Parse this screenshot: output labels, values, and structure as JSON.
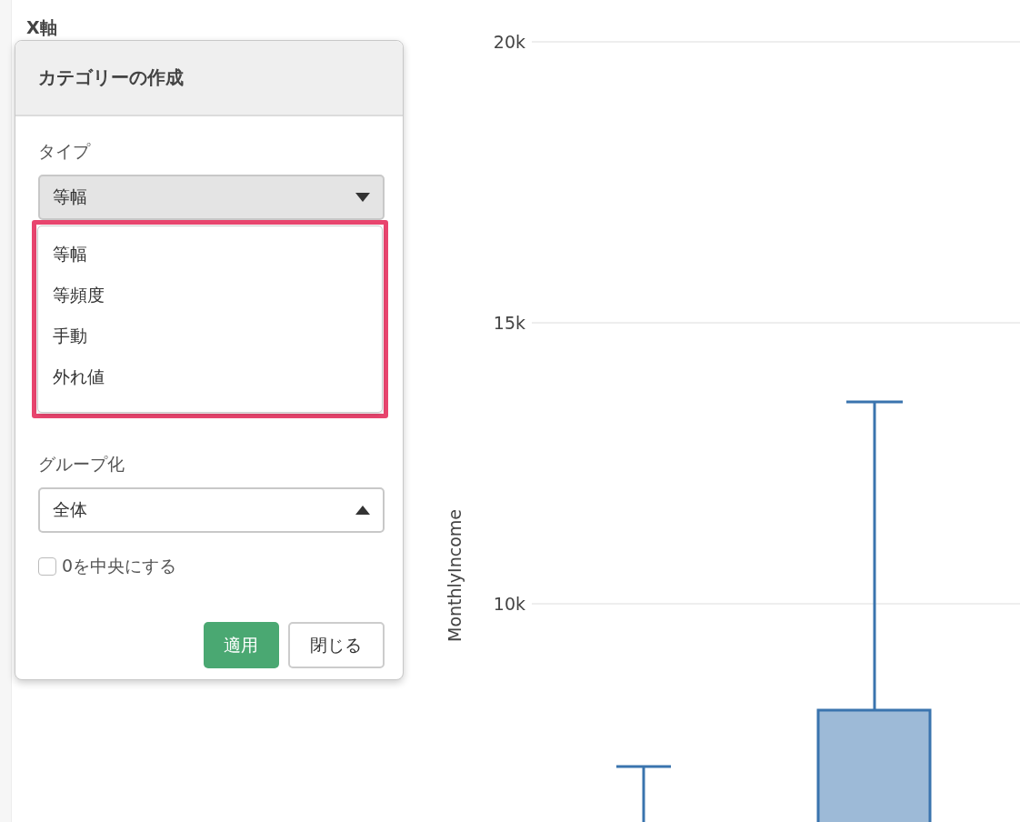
{
  "section_title": "X軸",
  "dialog": {
    "title": "カテゴリーの作成",
    "type_field": {
      "label": "タイプ",
      "value": "等幅",
      "expanded": true,
      "options": [
        "等幅",
        "等頻度",
        "手動",
        "外れ値"
      ]
    },
    "group_field": {
      "label": "グループ化",
      "value": "全体",
      "expanded": false
    },
    "center_zero": {
      "label": "0を中央にする",
      "checked": false
    },
    "buttons": [
      {
        "label": "適用",
        "kind": "primary"
      },
      {
        "label": "閉じる",
        "kind": "secondary"
      }
    ]
  },
  "chart": {
    "ylabel": "MonthlyIncome",
    "yticks": [
      "20k",
      "15k",
      "10k"
    ]
  }
}
